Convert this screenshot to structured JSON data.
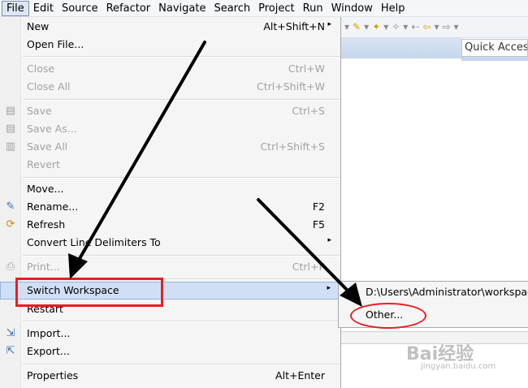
{
  "menubar": {
    "items": [
      {
        "label": "File",
        "active": true
      },
      {
        "label": "Edit"
      },
      {
        "label": "Source"
      },
      {
        "label": "Refactor"
      },
      {
        "label": "Navigate"
      },
      {
        "label": "Search"
      },
      {
        "label": "Project"
      },
      {
        "label": "Run"
      },
      {
        "label": "Window"
      },
      {
        "label": "Help"
      }
    ]
  },
  "quick_access": {
    "label": "Quick Access"
  },
  "file_menu": {
    "new": {
      "label": "New",
      "accel": "Alt+Shift+N",
      "arrow": "▸"
    },
    "open_file": {
      "label": "Open File..."
    },
    "close": {
      "label": "Close",
      "accel": "Ctrl+W"
    },
    "close_all": {
      "label": "Close All",
      "accel": "Ctrl+Shift+W"
    },
    "save": {
      "label": "Save",
      "accel": "Ctrl+S"
    },
    "save_as": {
      "label": "Save As..."
    },
    "save_all": {
      "label": "Save All",
      "accel": "Ctrl+Shift+S"
    },
    "revert": {
      "label": "Revert"
    },
    "move": {
      "label": "Move..."
    },
    "rename": {
      "label": "Rename...",
      "accel": "F2"
    },
    "refresh": {
      "label": "Refresh",
      "accel": "F5"
    },
    "convert": {
      "label": "Convert Line Delimiters To",
      "arrow": "▸"
    },
    "print": {
      "label": "Print...",
      "accel": "Ctrl+P"
    },
    "switch_workspace": {
      "label": "Switch Workspace",
      "arrow": "▸"
    },
    "restart": {
      "label": "Restart"
    },
    "import": {
      "label": "Import..."
    },
    "export": {
      "label": "Export..."
    },
    "properties": {
      "label": "Properties",
      "accel": "Alt+Enter"
    }
  },
  "switch_submenu": {
    "workspace_path": "D:\\Users\\Administrator\\workspace",
    "other": "Other..."
  },
  "watermark": {
    "text": "Bai经验",
    "url": "jingyan.baidu.com"
  },
  "colors": {
    "highlight": "#cfe0f6",
    "annotation_red": "#e81e25",
    "disabled_text": "#a2a2a2"
  }
}
